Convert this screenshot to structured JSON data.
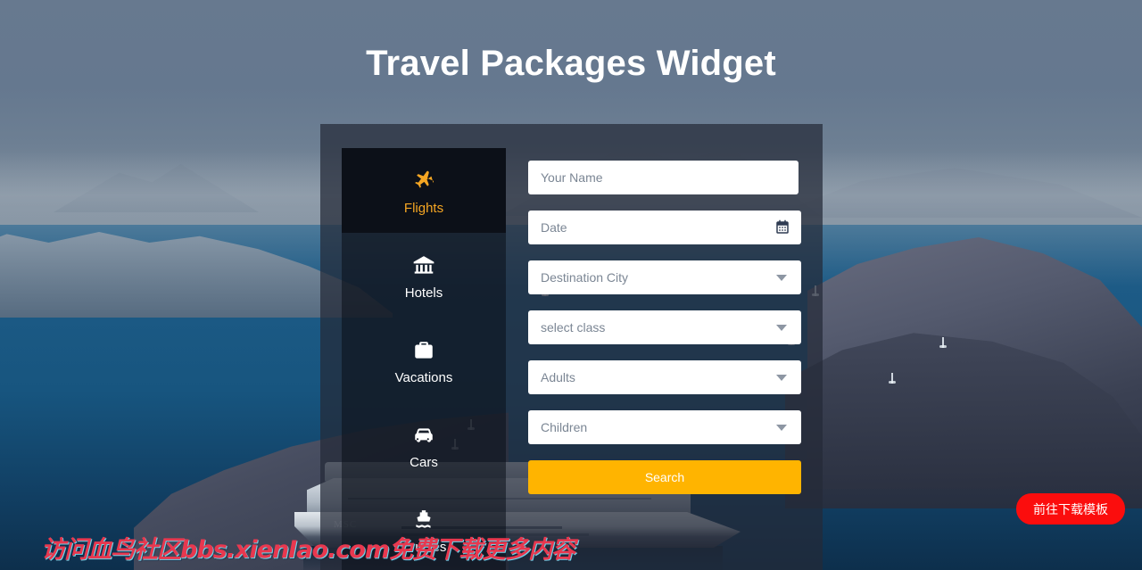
{
  "page": {
    "headline": "Travel Packages Widget",
    "background_scene": "coastal sea view with cruise ship",
    "colors": {
      "accent_orange": "#ffb400",
      "active_tab_orange": "#f5a623",
      "card_overlay": "rgba(36,42,56,0.72)",
      "sky": "#65788f",
      "sea": "#17557f",
      "download_red": "#fb0d0d",
      "watermark_red": "#e8384f"
    }
  },
  "widget": {
    "tabs": [
      {
        "label": "Flights",
        "icon": "airplane-icon",
        "active": true
      },
      {
        "label": "Hotels",
        "icon": "hotel-icon",
        "active": false
      },
      {
        "label": "Vacations",
        "icon": "suitcase-icon",
        "active": false
      },
      {
        "label": "Cars",
        "icon": "car-icon",
        "active": false
      },
      {
        "label": "Cruises",
        "icon": "ship-icon",
        "active": false
      }
    ],
    "form": {
      "name": {
        "placeholder": "Your Name",
        "value": ""
      },
      "date": {
        "placeholder": "Date",
        "value": "",
        "icon": "calendar-icon"
      },
      "destination": {
        "placeholder": "Destination City",
        "value": ""
      },
      "travel_class": {
        "placeholder": "select class",
        "value": ""
      },
      "adults": {
        "placeholder": "Adults",
        "value": ""
      },
      "children": {
        "placeholder": "Children",
        "value": ""
      },
      "submit_label": "Search"
    }
  },
  "overlays": {
    "download_button_label": "前往下载模板",
    "watermark": "访问血鸟社区bbs.xienIao.com免费下载更多内容"
  }
}
